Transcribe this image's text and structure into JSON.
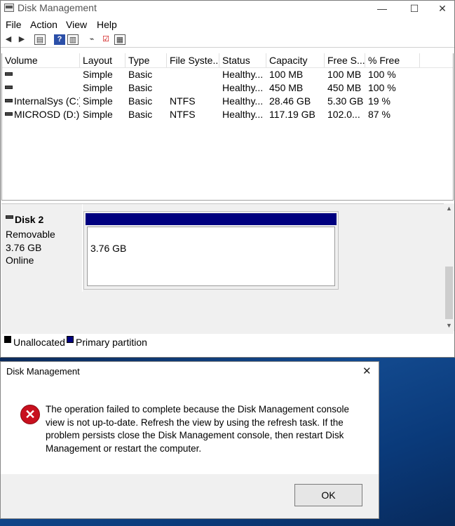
{
  "window": {
    "title": "Disk Management",
    "buttons": {
      "minimize": "—",
      "maximize": "☐",
      "close": "✕"
    }
  },
  "menu": [
    "File",
    "Action",
    "View",
    "Help"
  ],
  "toolbar": [
    "back-icon",
    "forward-icon",
    "properties-icon",
    "help-icon",
    "console-icon",
    "connect-icon",
    "check-icon",
    "settings-icon"
  ],
  "volumes": {
    "columns": [
      "Volume",
      "Layout",
      "Type",
      "File Syste...",
      "Status",
      "Capacity",
      "Free S...",
      "% Free"
    ],
    "rows": [
      {
        "volume": "",
        "layout": "Simple",
        "type": "Basic",
        "fs": "",
        "status": "Healthy...",
        "capacity": "100 MB",
        "free": "100 MB",
        "pct": "100 %"
      },
      {
        "volume": "",
        "layout": "Simple",
        "type": "Basic",
        "fs": "",
        "status": "Healthy...",
        "capacity": "450 MB",
        "free": "450 MB",
        "pct": "100 %"
      },
      {
        "volume": "InternalSys (C:)",
        "layout": "Simple",
        "type": "Basic",
        "fs": "NTFS",
        "status": "Healthy...",
        "capacity": "28.46 GB",
        "free": "5.30 GB",
        "pct": "19 %"
      },
      {
        "volume": "MICROSD (D:)",
        "layout": "Simple",
        "type": "Basic",
        "fs": "NTFS",
        "status": "Healthy...",
        "capacity": "117.19 GB",
        "free": "102.0...",
        "pct": "87 %"
      }
    ]
  },
  "disk": {
    "name": "Disk 2",
    "kind": "Removable",
    "size": "3.76 GB",
    "state": "Online",
    "partition_size": "3.76 GB",
    "partition_color": "#00007f"
  },
  "legend": [
    {
      "label": "Unallocated",
      "color": "#000000"
    },
    {
      "label": "Primary partition",
      "color": "#00007f"
    }
  ],
  "dialog": {
    "title": "Disk Management",
    "close": "✕",
    "icon": "error-icon",
    "message": "The operation failed to complete because the Disk Management console view is not up-to-date.  Refresh the view by using the refresh task. If the problem persists close the Disk Management console, then restart Disk Management or restart the computer.",
    "ok": "OK"
  }
}
